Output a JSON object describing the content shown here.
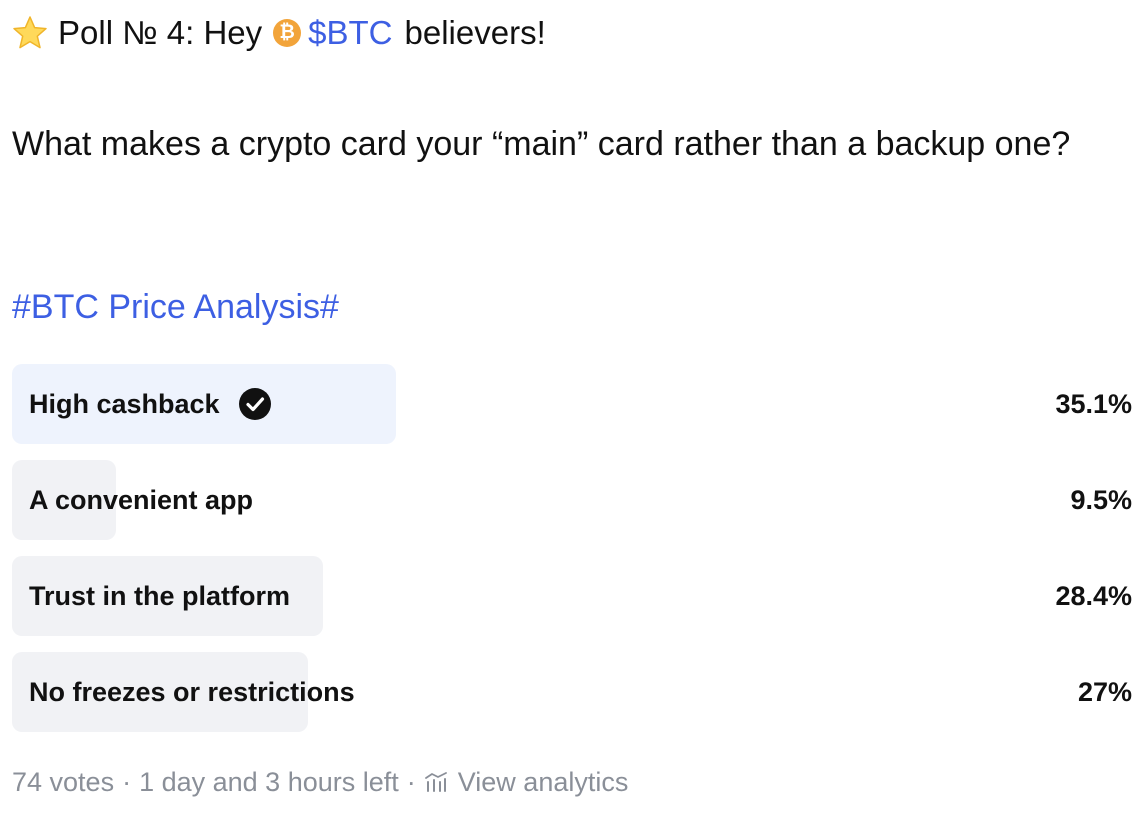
{
  "header": {
    "emoji_icon": "star-icon",
    "prefix": "Poll № 4: Hey",
    "coin_icon": "bitcoin-coin-icon",
    "coin_symbol": "₿",
    "ticker": "$BTC",
    "suffix": "believers!"
  },
  "question": "What makes a crypto card your “main” card rather than a backup one?",
  "hashtag": "#BTC Price Analysis#",
  "poll": {
    "options": [
      {
        "label": "High cashback",
        "percent": "35.1%",
        "share": 0.351,
        "selected": true
      },
      {
        "label": "A convenient app",
        "percent": "9.5%",
        "share": 0.095,
        "selected": false
      },
      {
        "label": "Trust in the platform",
        "percent": "28.4%",
        "share": 0.284,
        "selected": false
      },
      {
        "label": "No freezes or restrictions",
        "percent": "27%",
        "share": 0.27,
        "selected": false
      }
    ],
    "votes": "74 votes",
    "time_left": "1 day and 3 hours left",
    "separator": "·",
    "analytics_label": "View analytics"
  },
  "colors": {
    "link": "#3d5fe3",
    "coin": "#f2a43a",
    "bar": "#f1f2f5",
    "bar_selected": "#eef3fd",
    "muted_text": "#8a8f98"
  }
}
